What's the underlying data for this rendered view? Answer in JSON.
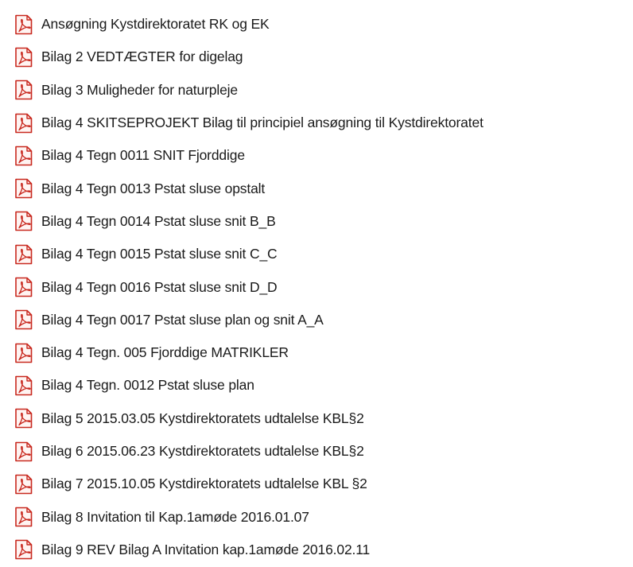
{
  "file_list": {
    "icon": "pdf-file-icon",
    "items": [
      {
        "name": "Ansøgning Kystdirektoratet RK og EK"
      },
      {
        "name": "Bilag 2 VEDTÆGTER for digelag"
      },
      {
        "name": "Bilag 3 Muligheder for naturpleje"
      },
      {
        "name": "Bilag 4 SKITSEPROJEKT Bilag til principiel ansøgning til Kystdirektoratet"
      },
      {
        "name": "Bilag 4 Tegn 0011 SNIT Fjorddige"
      },
      {
        "name": "Bilag 4 Tegn 0013 Pstat sluse opstalt"
      },
      {
        "name": "Bilag 4 Tegn 0014 Pstat sluse snit B_B"
      },
      {
        "name": "Bilag 4 Tegn 0015 Pstat sluse snit C_C"
      },
      {
        "name": "Bilag 4 Tegn 0016 Pstat sluse snit D_D"
      },
      {
        "name": "Bilag 4 Tegn 0017 Pstat sluse plan og snit A_A"
      },
      {
        "name": "Bilag 4 Tegn. 005 Fjorddige MATRIKLER"
      },
      {
        "name": "Bilag 4 Tegn. 0012 Pstat sluse plan"
      },
      {
        "name": "Bilag 5 2015.03.05 Kystdirektoratets udtalelse KBL§2"
      },
      {
        "name": "Bilag 6 2015.06.23 Kystdirektoratets udtalelse KBL§2"
      },
      {
        "name": "Bilag 7 2015.10.05 Kystdirektoratets udtalelse KBL §2"
      },
      {
        "name": "Bilag 8 Invitation til Kap.1amøde 2016.01.07"
      },
      {
        "name": "Bilag 9 REV Bilag A Invitation kap.1amøde 2016.02.11"
      }
    ]
  },
  "colors": {
    "pdf_icon_red": "#c8281e",
    "pdf_icon_bg": "#fff4f2",
    "text": "#1a1a1a"
  }
}
